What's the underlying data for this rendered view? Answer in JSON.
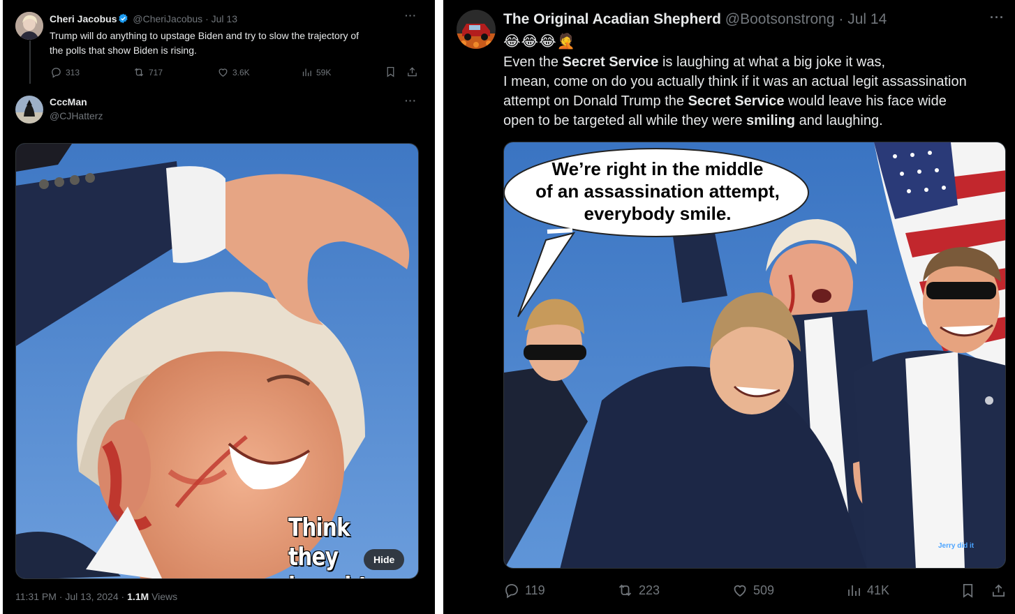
{
  "left": {
    "tweet1": {
      "name": "Cheri Jacobus",
      "handle": "@CheriJacobus",
      "date": "Jul 13",
      "text_line1": "Trump will do anything to upstage Biden and try to slow the trajectory of",
      "text_line2": "the polls that show Biden is rising.",
      "replies": "313",
      "reposts": "717",
      "likes": "3.6K",
      "views": "59K"
    },
    "tweet2": {
      "name": "CccMan",
      "handle": "@CJHatterz",
      "caption_line1": "Think they",
      "caption_line2": "bought",
      "hide_label": "Hide",
      "timestamp": "11:31 PM · Jul 13, 2024 · ",
      "views_count": "1.1M",
      "views_label": "Views"
    }
  },
  "right": {
    "tweet": {
      "name": "The Original Acadian Shepherd",
      "handle": "@Bootsonstrong",
      "date": "Jul 14",
      "emojis": "😂😂😂🤦",
      "line1": "Even the Secret Service is laughing at what a big joke it was,",
      "line2": "I mean, come on do you actually think if it was an actual legit assassination",
      "line3": "attempt on Donald Trump the Secret Service would leave his face wide",
      "line4": "open to be targeted all while they were smiling and laughing.",
      "bubble_line1": "We’re right in the middle",
      "bubble_line2": "of an assassination attempt,",
      "bubble_line3": "everybody smile.",
      "watermark": "Jerry did it",
      "replies": "119",
      "reposts": "223",
      "likes": "509",
      "views": "41K"
    }
  },
  "colors": {
    "background": "#000000",
    "text": "#e7e9ea",
    "muted": "#71767b",
    "verified": "#1d9bf0",
    "sky": "#4f86cf"
  }
}
